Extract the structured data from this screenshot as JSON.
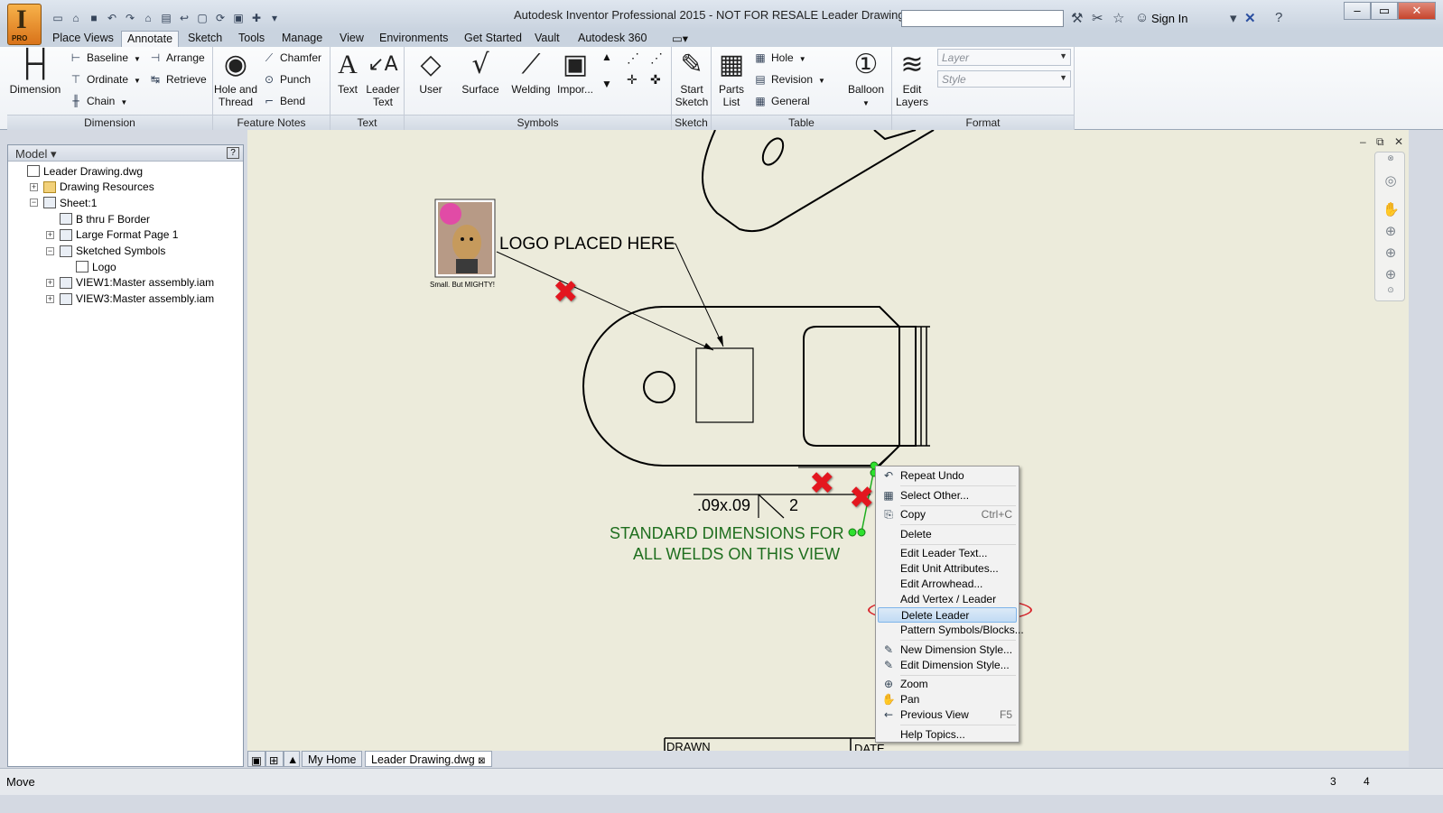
{
  "window": {
    "title": "Autodesk Inventor Professional 2015 - NOT FOR RESALE     Leader Drawing.dwg",
    "app_badge": "PRO",
    "sign_in": "Sign In"
  },
  "ribbon_tabs": [
    "Place Views",
    "Annotate",
    "Sketch",
    "Tools",
    "Manage",
    "View",
    "Environments",
    "Get Started",
    "Vault",
    "Autodesk 360"
  ],
  "active_tab": "Annotate",
  "ribbon": {
    "dimension": {
      "title": "Dimension",
      "big": "Dimension",
      "baseline": "Baseline",
      "ordinate": "Ordinate",
      "chain": "Chain",
      "arrange": "Arrange",
      "retrieve": "Retrieve"
    },
    "feature_notes": {
      "title": "Feature Notes",
      "hole_thread_1": "Hole and",
      "hole_thread_2": "Thread",
      "chamfer": "Chamfer",
      "punch": "Punch",
      "bend": "Bend"
    },
    "text": {
      "title": "Text",
      "text": "Text",
      "leader_1": "Leader",
      "leader_2": "Text"
    },
    "symbols": {
      "title": "Symbols",
      "user": "User",
      "surface": "Surface",
      "welding": "Welding",
      "import": "Impor..."
    },
    "sketch": {
      "title": "Sketch",
      "start_1": "Start",
      "start_2": "Sketch"
    },
    "table": {
      "title": "Table",
      "parts_1": "Parts",
      "parts_2": "List",
      "hole": "Hole",
      "revision": "Revision",
      "general": "General",
      "balloon": "Balloon"
    },
    "format": {
      "title": "Format",
      "edit_1": "Edit",
      "edit_2": "Layers",
      "layer_placeholder": "Layer",
      "style_placeholder": "Style"
    }
  },
  "browser": {
    "title": "Model",
    "help": "?",
    "items": [
      {
        "label": "Leader Drawing.dwg",
        "level": 0,
        "icon": "drawing-icon",
        "expander": ""
      },
      {
        "label": "Drawing Resources",
        "level": 1,
        "icon": "folder-icon",
        "expander": "+"
      },
      {
        "label": "Sheet:1",
        "level": 1,
        "icon": "sheet-icon",
        "expander": "−"
      },
      {
        "label": "B thru F Border",
        "level": 2,
        "icon": "border-icon",
        "expander": ""
      },
      {
        "label": "Large Format Page 1",
        "level": 2,
        "icon": "titleblock-icon",
        "expander": "+"
      },
      {
        "label": "Sketched Symbols",
        "level": 2,
        "icon": "symbols-icon",
        "expander": "−"
      },
      {
        "label": "Logo",
        "level": 3,
        "icon": "symbol-icon",
        "expander": ""
      },
      {
        "label": "VIEW1:Master assembly.iam",
        "level": 2,
        "icon": "view-icon",
        "expander": "+"
      },
      {
        "label": "VIEW3:Master assembly.iam",
        "level": 2,
        "icon": "view-icon",
        "expander": "+"
      }
    ]
  },
  "drawing": {
    "logo_caption": "Small.  But MIGHTY!",
    "leader_note": "LOGO PLACED HERE",
    "weld_dim_left": ".09x.09",
    "weld_dim_right": "2",
    "weld_note_1": "STANDARD DIMENSIONS FOR",
    "weld_note_2": "ALL WELDS ON THIS VIEW",
    "title_block_drawn": "DRAWN",
    "title_block_date": "DATE"
  },
  "context_menu": [
    {
      "label": "Repeat Undo",
      "shortcut": "",
      "icon": "undo-icon"
    },
    {
      "label": "Select Other...",
      "shortcut": "",
      "icon": "select-other-icon"
    },
    {
      "label": "Copy",
      "shortcut": "Ctrl+C",
      "icon": "copy-icon"
    },
    {
      "label": "Delete",
      "shortcut": "",
      "icon": ""
    },
    {
      "label": "Edit Leader Text...",
      "shortcut": "",
      "icon": ""
    },
    {
      "label": "Edit Unit Attributes...",
      "shortcut": "",
      "icon": ""
    },
    {
      "label": "Edit Arrowhead...",
      "shortcut": "",
      "icon": ""
    },
    {
      "label": "Add Vertex / Leader",
      "shortcut": "",
      "icon": ""
    },
    {
      "label": "Delete Leader",
      "shortcut": "",
      "icon": ""
    },
    {
      "label": "Pattern Symbols/Blocks...",
      "shortcut": "",
      "icon": ""
    },
    {
      "label": "New Dimension Style...",
      "shortcut": "",
      "icon": "dim-style-icon"
    },
    {
      "label": "Edit Dimension Style...",
      "shortcut": "",
      "icon": "dim-style-icon"
    },
    {
      "label": "Zoom",
      "shortcut": "",
      "icon": "zoom-icon"
    },
    {
      "label": "Pan",
      "shortcut": "",
      "icon": "pan-icon"
    },
    {
      "label": "Previous View",
      "shortcut": "F5",
      "icon": "previous-view-icon"
    },
    {
      "label": "Help Topics...",
      "shortcut": "",
      "icon": ""
    }
  ],
  "highlighted_menu_item": "Delete Leader",
  "document_tabs": [
    "My Home",
    "Leader Drawing.dwg"
  ],
  "status": {
    "text": "Move",
    "num1": "3",
    "num2": "4"
  },
  "colors": {
    "note_green": "#1e6e1e",
    "annotation_red": "#e3161f",
    "canvas_bg": "#ecebdb"
  }
}
